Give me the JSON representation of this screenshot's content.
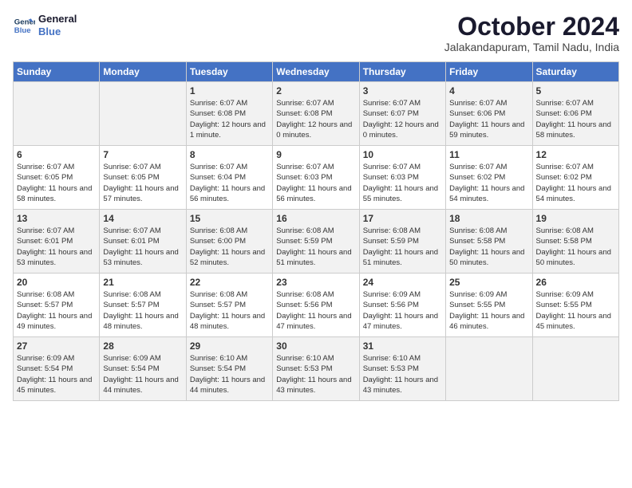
{
  "header": {
    "logo_line1": "General",
    "logo_line2": "Blue",
    "title": "October 2024",
    "subtitle": "Jalakandapuram, Tamil Nadu, India"
  },
  "weekdays": [
    "Sunday",
    "Monday",
    "Tuesday",
    "Wednesday",
    "Thursday",
    "Friday",
    "Saturday"
  ],
  "weeks": [
    [
      {
        "day": "",
        "info": ""
      },
      {
        "day": "",
        "info": ""
      },
      {
        "day": "1",
        "info": "Sunrise: 6:07 AM\nSunset: 6:08 PM\nDaylight: 12 hours\nand 1 minute."
      },
      {
        "day": "2",
        "info": "Sunrise: 6:07 AM\nSunset: 6:08 PM\nDaylight: 12 hours\nand 0 minutes."
      },
      {
        "day": "3",
        "info": "Sunrise: 6:07 AM\nSunset: 6:07 PM\nDaylight: 12 hours\nand 0 minutes."
      },
      {
        "day": "4",
        "info": "Sunrise: 6:07 AM\nSunset: 6:06 PM\nDaylight: 11 hours\nand 59 minutes."
      },
      {
        "day": "5",
        "info": "Sunrise: 6:07 AM\nSunset: 6:06 PM\nDaylight: 11 hours\nand 58 minutes."
      }
    ],
    [
      {
        "day": "6",
        "info": "Sunrise: 6:07 AM\nSunset: 6:05 PM\nDaylight: 11 hours\nand 58 minutes."
      },
      {
        "day": "7",
        "info": "Sunrise: 6:07 AM\nSunset: 6:05 PM\nDaylight: 11 hours\nand 57 minutes."
      },
      {
        "day": "8",
        "info": "Sunrise: 6:07 AM\nSunset: 6:04 PM\nDaylight: 11 hours\nand 56 minutes."
      },
      {
        "day": "9",
        "info": "Sunrise: 6:07 AM\nSunset: 6:03 PM\nDaylight: 11 hours\nand 56 minutes."
      },
      {
        "day": "10",
        "info": "Sunrise: 6:07 AM\nSunset: 6:03 PM\nDaylight: 11 hours\nand 55 minutes."
      },
      {
        "day": "11",
        "info": "Sunrise: 6:07 AM\nSunset: 6:02 PM\nDaylight: 11 hours\nand 54 minutes."
      },
      {
        "day": "12",
        "info": "Sunrise: 6:07 AM\nSunset: 6:02 PM\nDaylight: 11 hours\nand 54 minutes."
      }
    ],
    [
      {
        "day": "13",
        "info": "Sunrise: 6:07 AM\nSunset: 6:01 PM\nDaylight: 11 hours\nand 53 minutes."
      },
      {
        "day": "14",
        "info": "Sunrise: 6:07 AM\nSunset: 6:01 PM\nDaylight: 11 hours\nand 53 minutes."
      },
      {
        "day": "15",
        "info": "Sunrise: 6:08 AM\nSunset: 6:00 PM\nDaylight: 11 hours\nand 52 minutes."
      },
      {
        "day": "16",
        "info": "Sunrise: 6:08 AM\nSunset: 5:59 PM\nDaylight: 11 hours\nand 51 minutes."
      },
      {
        "day": "17",
        "info": "Sunrise: 6:08 AM\nSunset: 5:59 PM\nDaylight: 11 hours\nand 51 minutes."
      },
      {
        "day": "18",
        "info": "Sunrise: 6:08 AM\nSunset: 5:58 PM\nDaylight: 11 hours\nand 50 minutes."
      },
      {
        "day": "19",
        "info": "Sunrise: 6:08 AM\nSunset: 5:58 PM\nDaylight: 11 hours\nand 50 minutes."
      }
    ],
    [
      {
        "day": "20",
        "info": "Sunrise: 6:08 AM\nSunset: 5:57 PM\nDaylight: 11 hours\nand 49 minutes."
      },
      {
        "day": "21",
        "info": "Sunrise: 6:08 AM\nSunset: 5:57 PM\nDaylight: 11 hours\nand 48 minutes."
      },
      {
        "day": "22",
        "info": "Sunrise: 6:08 AM\nSunset: 5:57 PM\nDaylight: 11 hours\nand 48 minutes."
      },
      {
        "day": "23",
        "info": "Sunrise: 6:08 AM\nSunset: 5:56 PM\nDaylight: 11 hours\nand 47 minutes."
      },
      {
        "day": "24",
        "info": "Sunrise: 6:09 AM\nSunset: 5:56 PM\nDaylight: 11 hours\nand 47 minutes."
      },
      {
        "day": "25",
        "info": "Sunrise: 6:09 AM\nSunset: 5:55 PM\nDaylight: 11 hours\nand 46 minutes."
      },
      {
        "day": "26",
        "info": "Sunrise: 6:09 AM\nSunset: 5:55 PM\nDaylight: 11 hours\nand 45 minutes."
      }
    ],
    [
      {
        "day": "27",
        "info": "Sunrise: 6:09 AM\nSunset: 5:54 PM\nDaylight: 11 hours\nand 45 minutes."
      },
      {
        "day": "28",
        "info": "Sunrise: 6:09 AM\nSunset: 5:54 PM\nDaylight: 11 hours\nand 44 minutes."
      },
      {
        "day": "29",
        "info": "Sunrise: 6:10 AM\nSunset: 5:54 PM\nDaylight: 11 hours\nand 44 minutes."
      },
      {
        "day": "30",
        "info": "Sunrise: 6:10 AM\nSunset: 5:53 PM\nDaylight: 11 hours\nand 43 minutes."
      },
      {
        "day": "31",
        "info": "Sunrise: 6:10 AM\nSunset: 5:53 PM\nDaylight: 11 hours\nand 43 minutes."
      },
      {
        "day": "",
        "info": ""
      },
      {
        "day": "",
        "info": ""
      }
    ]
  ]
}
